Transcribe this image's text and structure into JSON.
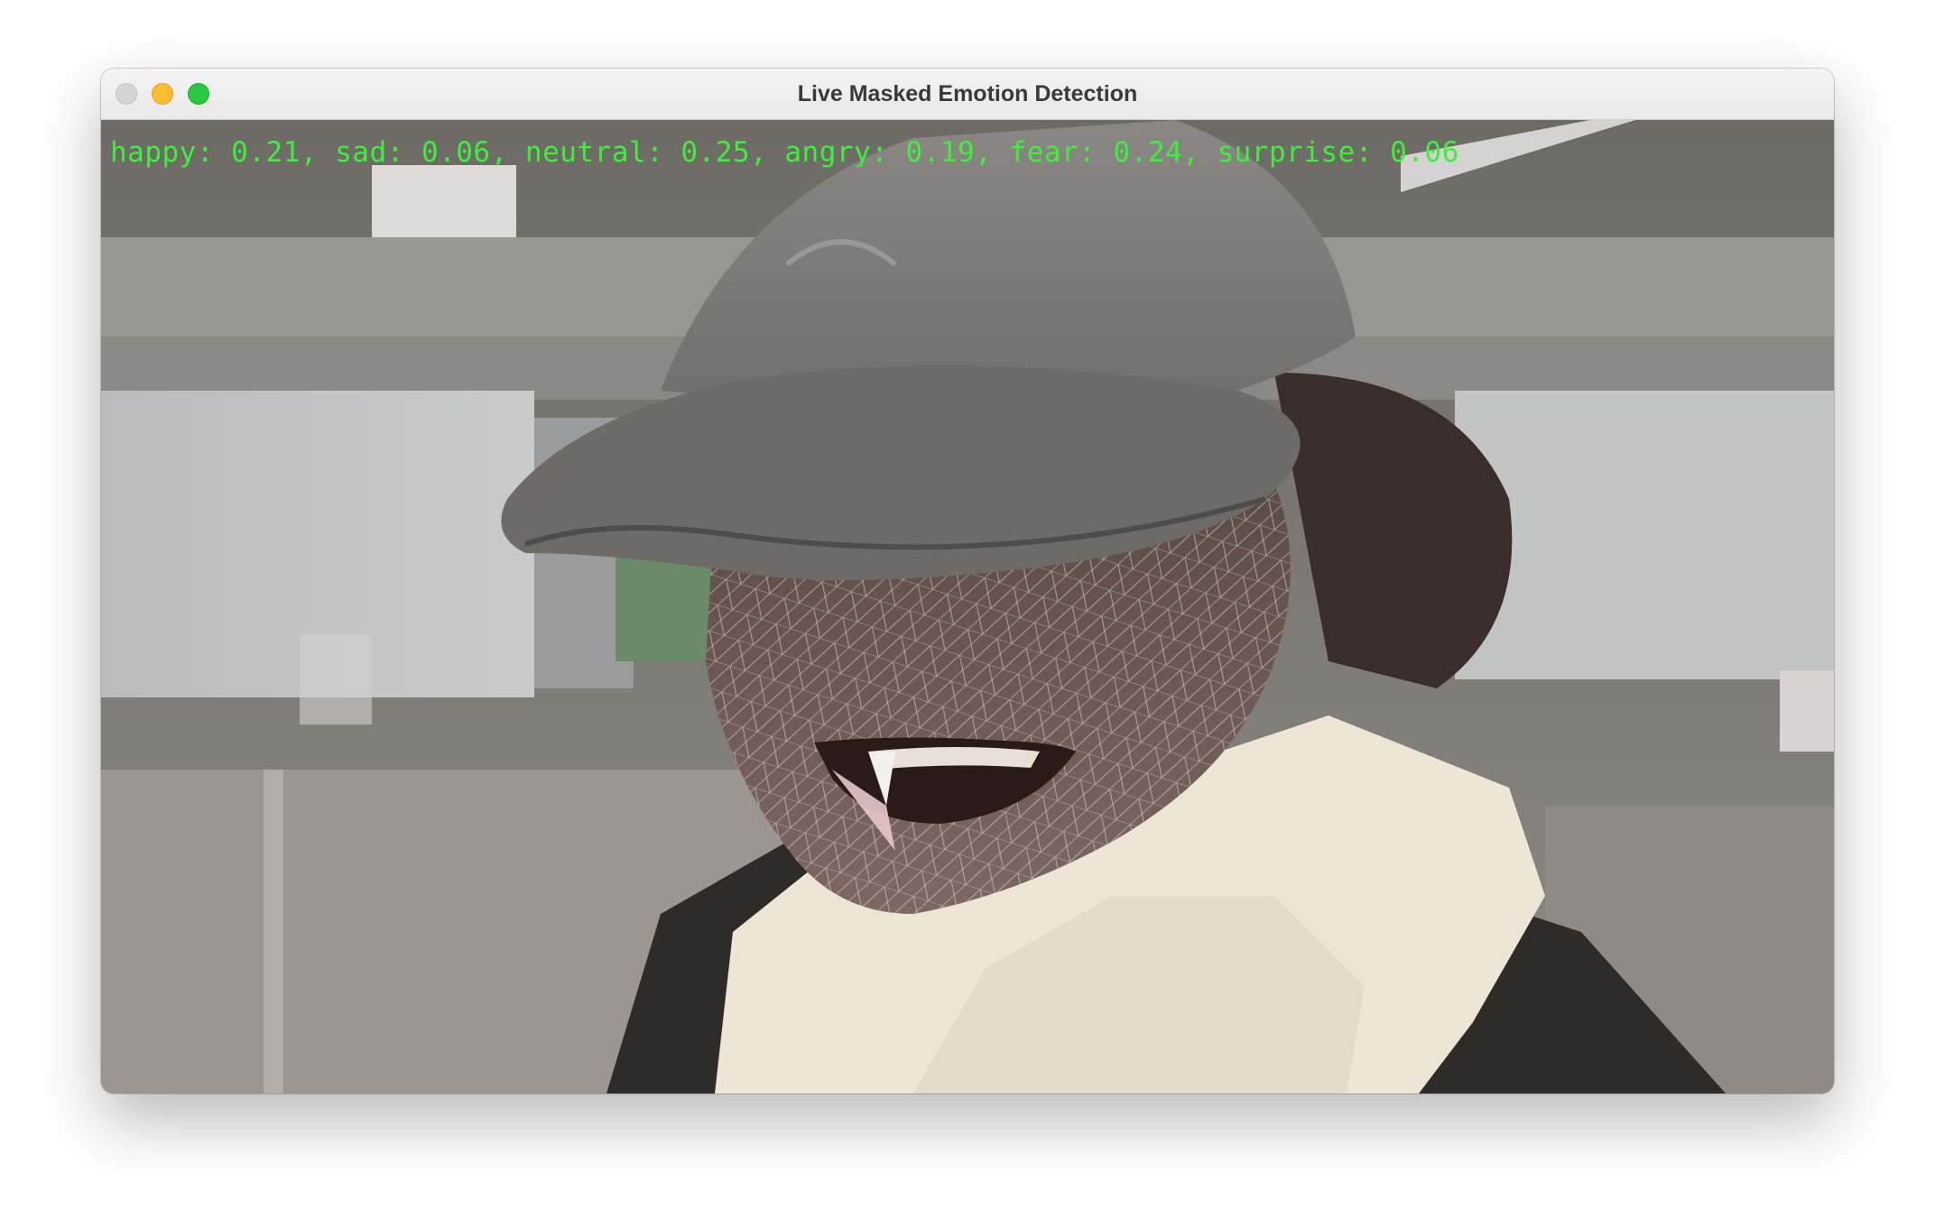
{
  "window": {
    "title": "Live Masked Emotion Detection"
  },
  "controls": {
    "close": "close-icon",
    "minimize": "minimize-icon",
    "zoom": "zoom-icon"
  },
  "overlay": {
    "emotions_text": "happy: 0.21, sad: 0.06, neutral: 0.25, angry: 0.19, fear: 0.24, surprise: 0.06",
    "text_color": "#3cf03c"
  }
}
